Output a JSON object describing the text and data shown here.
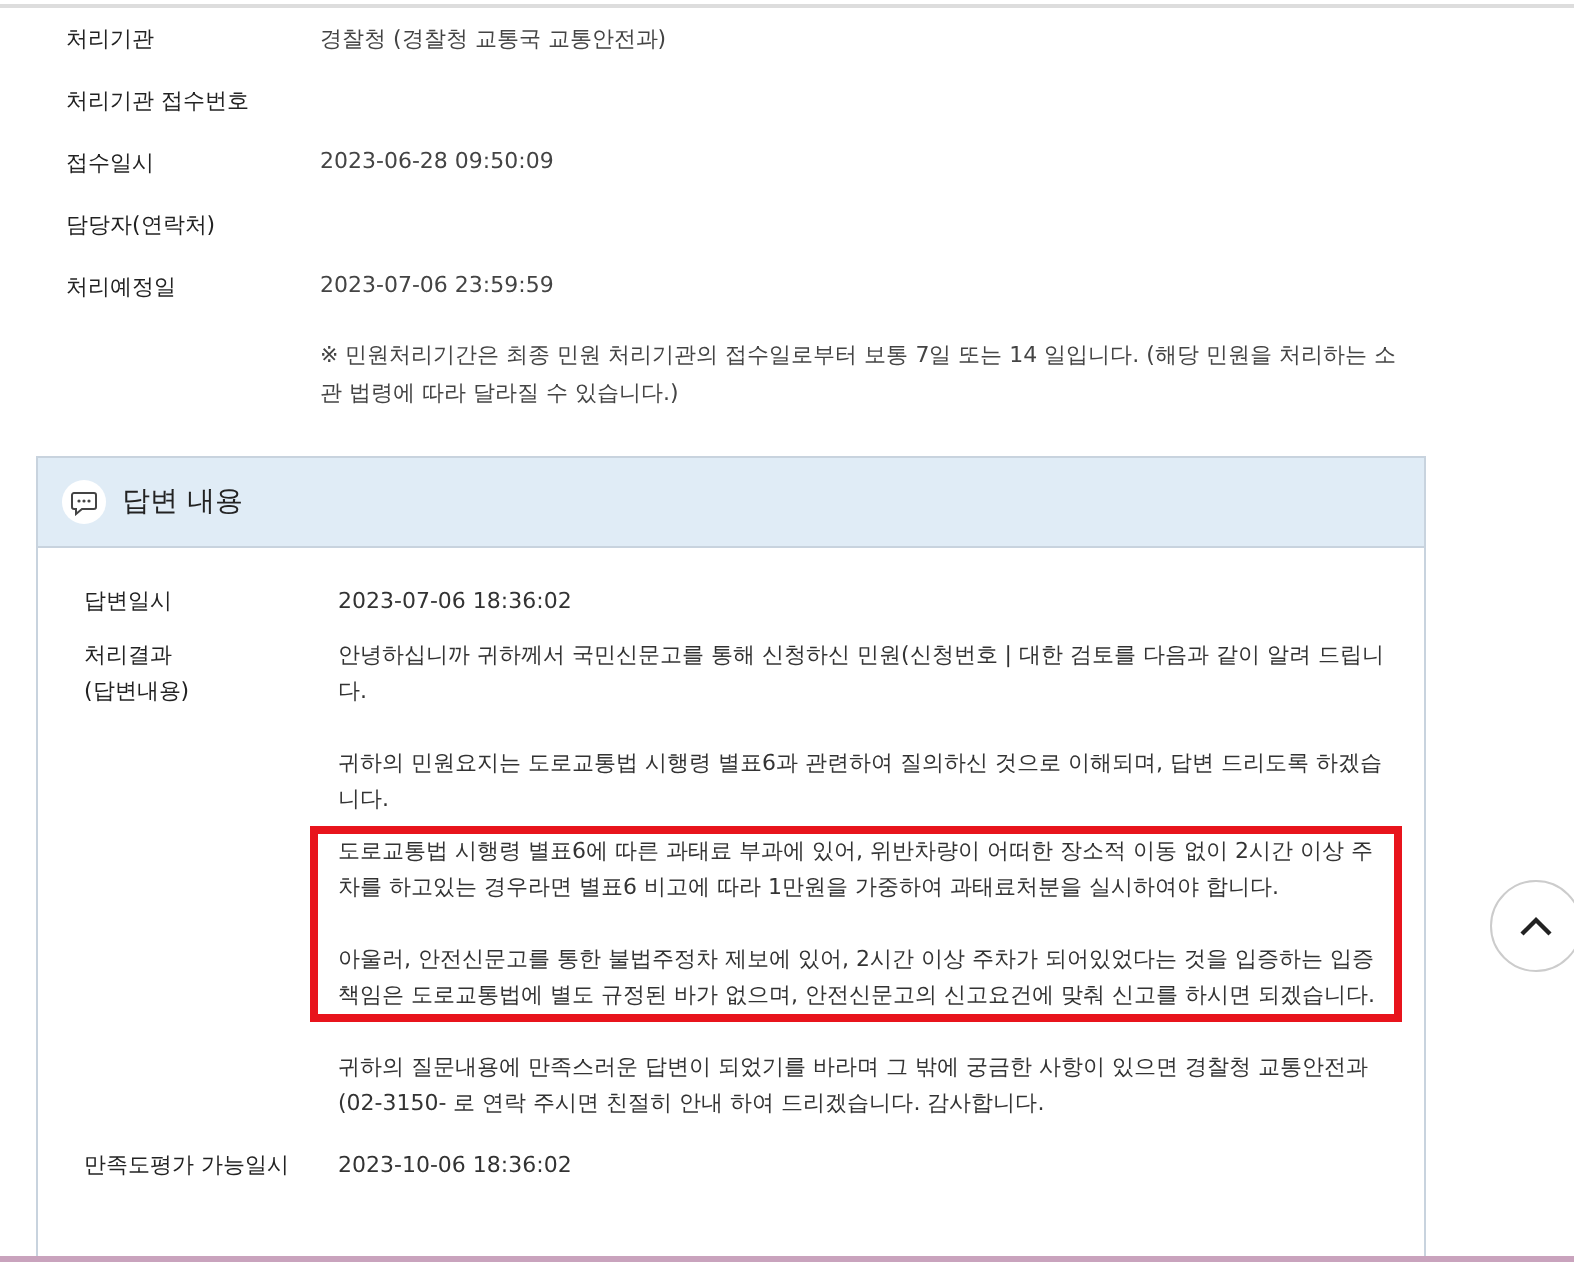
{
  "info_rows": [
    {
      "label": "처리기관",
      "value": "경찰청 (경찰청 교통국 교통안전과)"
    },
    {
      "label": "처리기관 접수번호",
      "value": ""
    },
    {
      "label": "접수일시",
      "value": "2023-06-28 09:50:09"
    },
    {
      "label": "담당자(연락처)",
      "value": ""
    },
    {
      "label": "처리예정일",
      "value": "2023-07-06 23:59:59"
    }
  ],
  "notice": "※ 민원처리기간은 최종 민원 처리기관의 접수일로부터 보통 7일 또는 14 일입니다. (해당 민원을 처리하는 소관 법령에 따라 달라질 수 있습니다.)",
  "answer": {
    "title": "답변 내용",
    "date_label": "답변일시",
    "date": "2023-07-06 18:36:02",
    "result_label": "처리결과\n(답변내용)",
    "paragraphs": [
      {
        "text": "안녕하십니까 귀하께서 국민신문고를 통해 신청하신 민원(신청번호 | 대한 검토를 다음과 같이 알려 드립니다.",
        "highlighted": false
      },
      {
        "text": "귀하의 민원요지는 도로교통법 시행령 별표6과 관련하여 질의하신 것으로 이해되며, 답변 드리도록 하겠습니다.",
        "highlighted": false
      },
      {
        "text": "도로교통법 시행령 별표6에 따른 과태료 부과에 있어, 위반차량이 어떠한 장소적 이동 없이 2시간 이상 주차를 하고있는 경우라면 별표6 비고에 따라 1만원을 가중하여 과태료처분을 실시하여야 합니다.",
        "highlighted": true
      },
      {
        "text": "아울러, 안전신문고를 통한 불법주정차 제보에 있어, 2시간 이상 주차가 되어있었다는 것을 입증하는 입증책임은 도로교통법에 별도 규정된 바가 없으며, 안전신문고의 신고요건에 맞춰 신고를 하시면 되겠습니다.",
        "highlighted": true
      },
      {
        "text": "귀하의 질문내용에 만족스러운 답변이 되었기를 바라며 그 밖에 궁금한 사항이 있으면 경찰청 교통안전과(02-3150- 로 연락 주시면 친절히 안내 하여 드리겠습니다. 감사합니다.",
        "highlighted": false
      }
    ],
    "eval_label": "만족도평가 가능일시",
    "eval_date": "2023-10-06 18:36:02"
  }
}
